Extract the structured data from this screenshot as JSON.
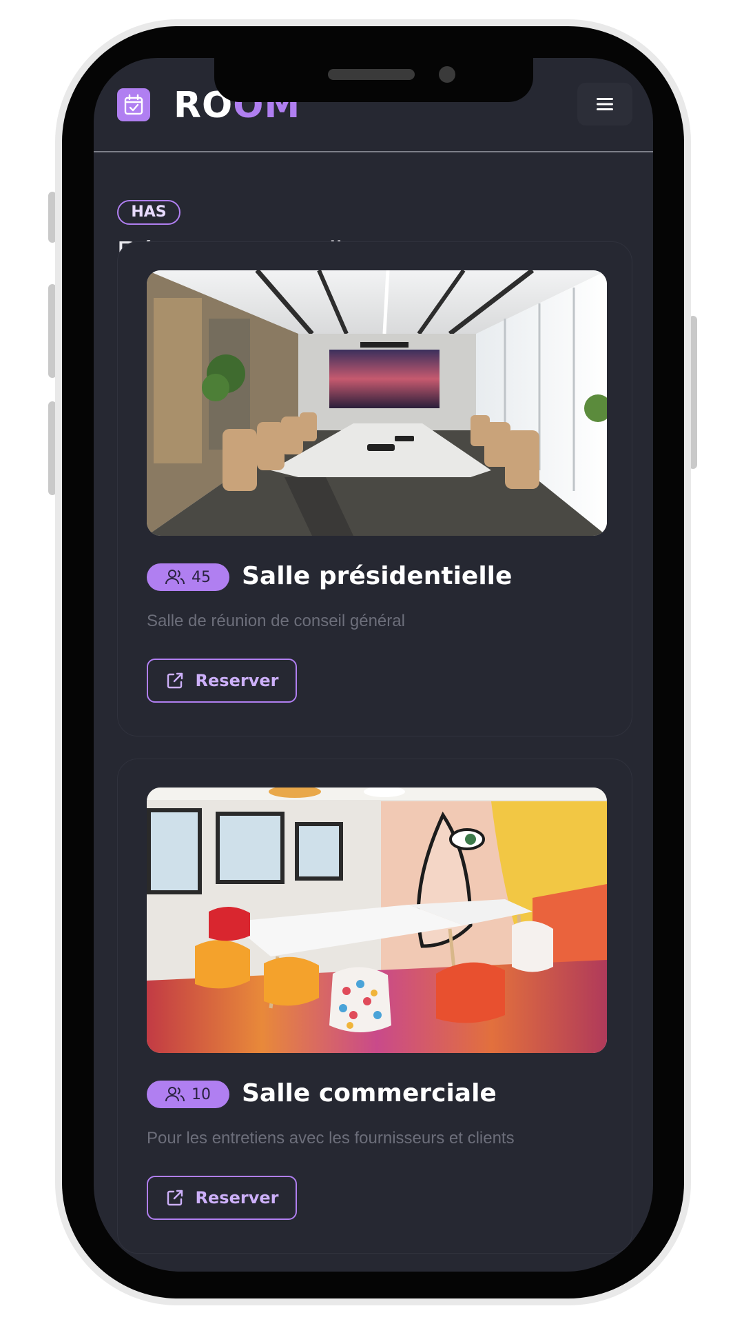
{
  "app": {
    "brand_part1": "RO",
    "brand_part2": "OM",
    "logo_icon": "calendar-check-icon",
    "menu_icon": "hamburger-menu-icon"
  },
  "page": {
    "tag": "HAS",
    "title": "Réserver une salle"
  },
  "rooms": [
    {
      "name": "Salle présidentielle",
      "capacity": "45",
      "description": "Salle de réunion de conseil général",
      "button_label": "Reserver",
      "image_subject": "boardroom-photo"
    },
    {
      "name": "Salle commerciale",
      "capacity": "10",
      "description": "Pour les entretiens avec les fournisseurs et clients",
      "button_label": "Reserver",
      "image_subject": "colorful-meeting-room-photo"
    }
  ],
  "colors": {
    "accent": "#b07ff1",
    "background": "#262832",
    "text": "#ffffff",
    "muted": "#6c6e7a"
  }
}
